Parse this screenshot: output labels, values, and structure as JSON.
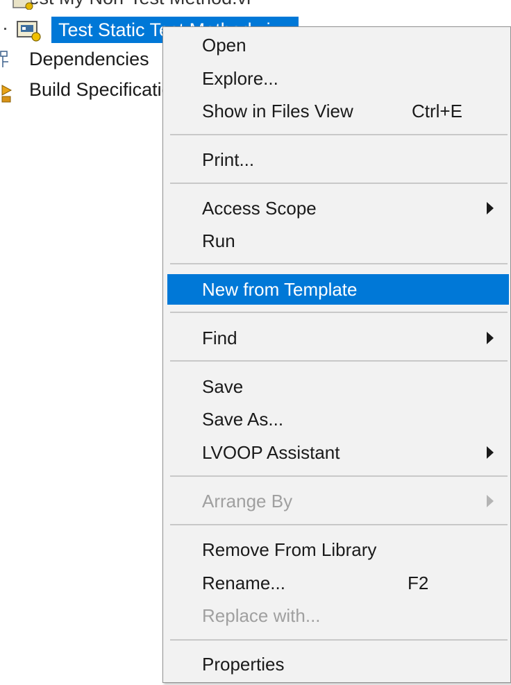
{
  "tree": {
    "top_item_label": "Test My Non-Test Method.vi",
    "selected_item_label": "Test Static Test Method.vi",
    "dependencies_label": "Dependencies",
    "build_specs_label": "Build Specifications"
  },
  "menu": {
    "open": "Open",
    "explore": "Explore...",
    "show_in_files_view": "Show in Files View",
    "show_in_files_view_shortcut": "Ctrl+E",
    "print": "Print...",
    "access_scope": "Access Scope",
    "run": "Run",
    "new_from_template": "New from Template",
    "find": "Find",
    "save": "Save",
    "save_as": "Save As...",
    "lvoop_assistant": "LVOOP Assistant",
    "arrange_by": "Arrange By",
    "remove_from_library": "Remove From Library",
    "rename": "Rename...",
    "rename_shortcut": "F2",
    "replace_with": "Replace with...",
    "properties": "Properties"
  },
  "colors": {
    "selection": "#0078d7",
    "menu_background": "#f2f2f2",
    "disabled_text": "#a0a0a0"
  }
}
